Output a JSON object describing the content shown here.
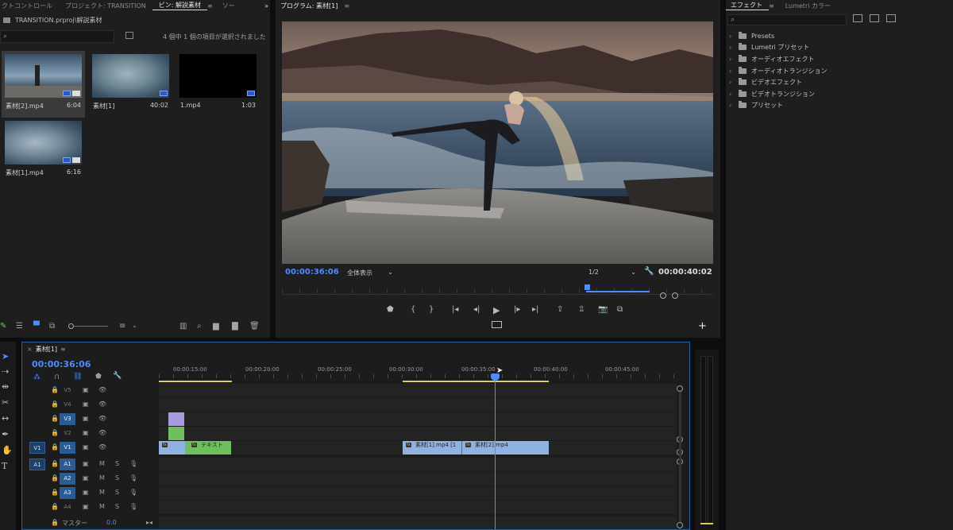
{
  "bin_panel": {
    "tabs": [
      {
        "label": "クトコントロール"
      },
      {
        "label": "プロジェクト: TRANSITION"
      },
      {
        "label": "ビン: 解説素材"
      },
      {
        "label": "ソー"
      }
    ],
    "menu_glyph": "≡",
    "more_glyph": "»",
    "path": "TRANSITION.prproj\\解説素材",
    "selection_status": "4 個中 1 個の項目が選択されました",
    "clips": [
      {
        "name": "素材[2].mp4",
        "duration": "6:04"
      },
      {
        "name": "素材[1]",
        "duration": "40:02"
      },
      {
        "name": "1.mp4",
        "duration": "1:03"
      },
      {
        "name": "素材[1].mp4",
        "duration": "6:16"
      }
    ]
  },
  "program_monitor": {
    "tab_label": "プログラム: 素材[1]",
    "menu_glyph": "≡",
    "current_timecode": "00:00:36:06",
    "zoom_label": "全体表示",
    "resolution": "1/2",
    "duration_timecode": "00:00:40:02"
  },
  "effects_panel": {
    "tabs": [
      {
        "label": "エフェクト"
      },
      {
        "label": "Lumetri カラー"
      }
    ],
    "menu_glyph": "≡",
    "items": [
      {
        "label": "Presets"
      },
      {
        "label": "Lumetri プリセット"
      },
      {
        "label": "オーディオエフェクト"
      },
      {
        "label": "オーディオトランジション"
      },
      {
        "label": "ビデオエフェクト"
      },
      {
        "label": "ビデオトランジション"
      },
      {
        "label": "プリセット"
      }
    ]
  },
  "timeline": {
    "tab_label": "素材[1]",
    "close_glyph": "×",
    "menu_glyph": "≡",
    "current_timecode": "00:00:36:06",
    "ruler_labels": [
      "00:00:15:00",
      "00:00:20:00",
      "00:00:25:00",
      "00:00:30:00",
      "00:00:35:00",
      "00:00:40:00",
      "00:00:45:00"
    ],
    "video_tracks": [
      "V5",
      "V4",
      "V3",
      "V2",
      "V1"
    ],
    "audio_tracks": [
      "A1",
      "A2",
      "A3",
      "A4"
    ],
    "source_patch_video": "V1",
    "source_patch_audio": "A1",
    "mute_label": "M",
    "solo_label": "S",
    "master_label": "マスター",
    "master_value": "0.0",
    "clips": [
      {
        "label": "テキスト",
        "track": "V1"
      },
      {
        "label": "素材[1].mp4 [1",
        "track": "V1"
      },
      {
        "label": "素材[2].mp4",
        "track": "V1"
      }
    ]
  },
  "colors": {
    "accent_blue": "#4f8cff",
    "clip_blue": "#8fb2e0",
    "clip_green": "#6fbf5f",
    "clip_violet": "#a99be0",
    "panel_bg": "#1e1e1e"
  }
}
